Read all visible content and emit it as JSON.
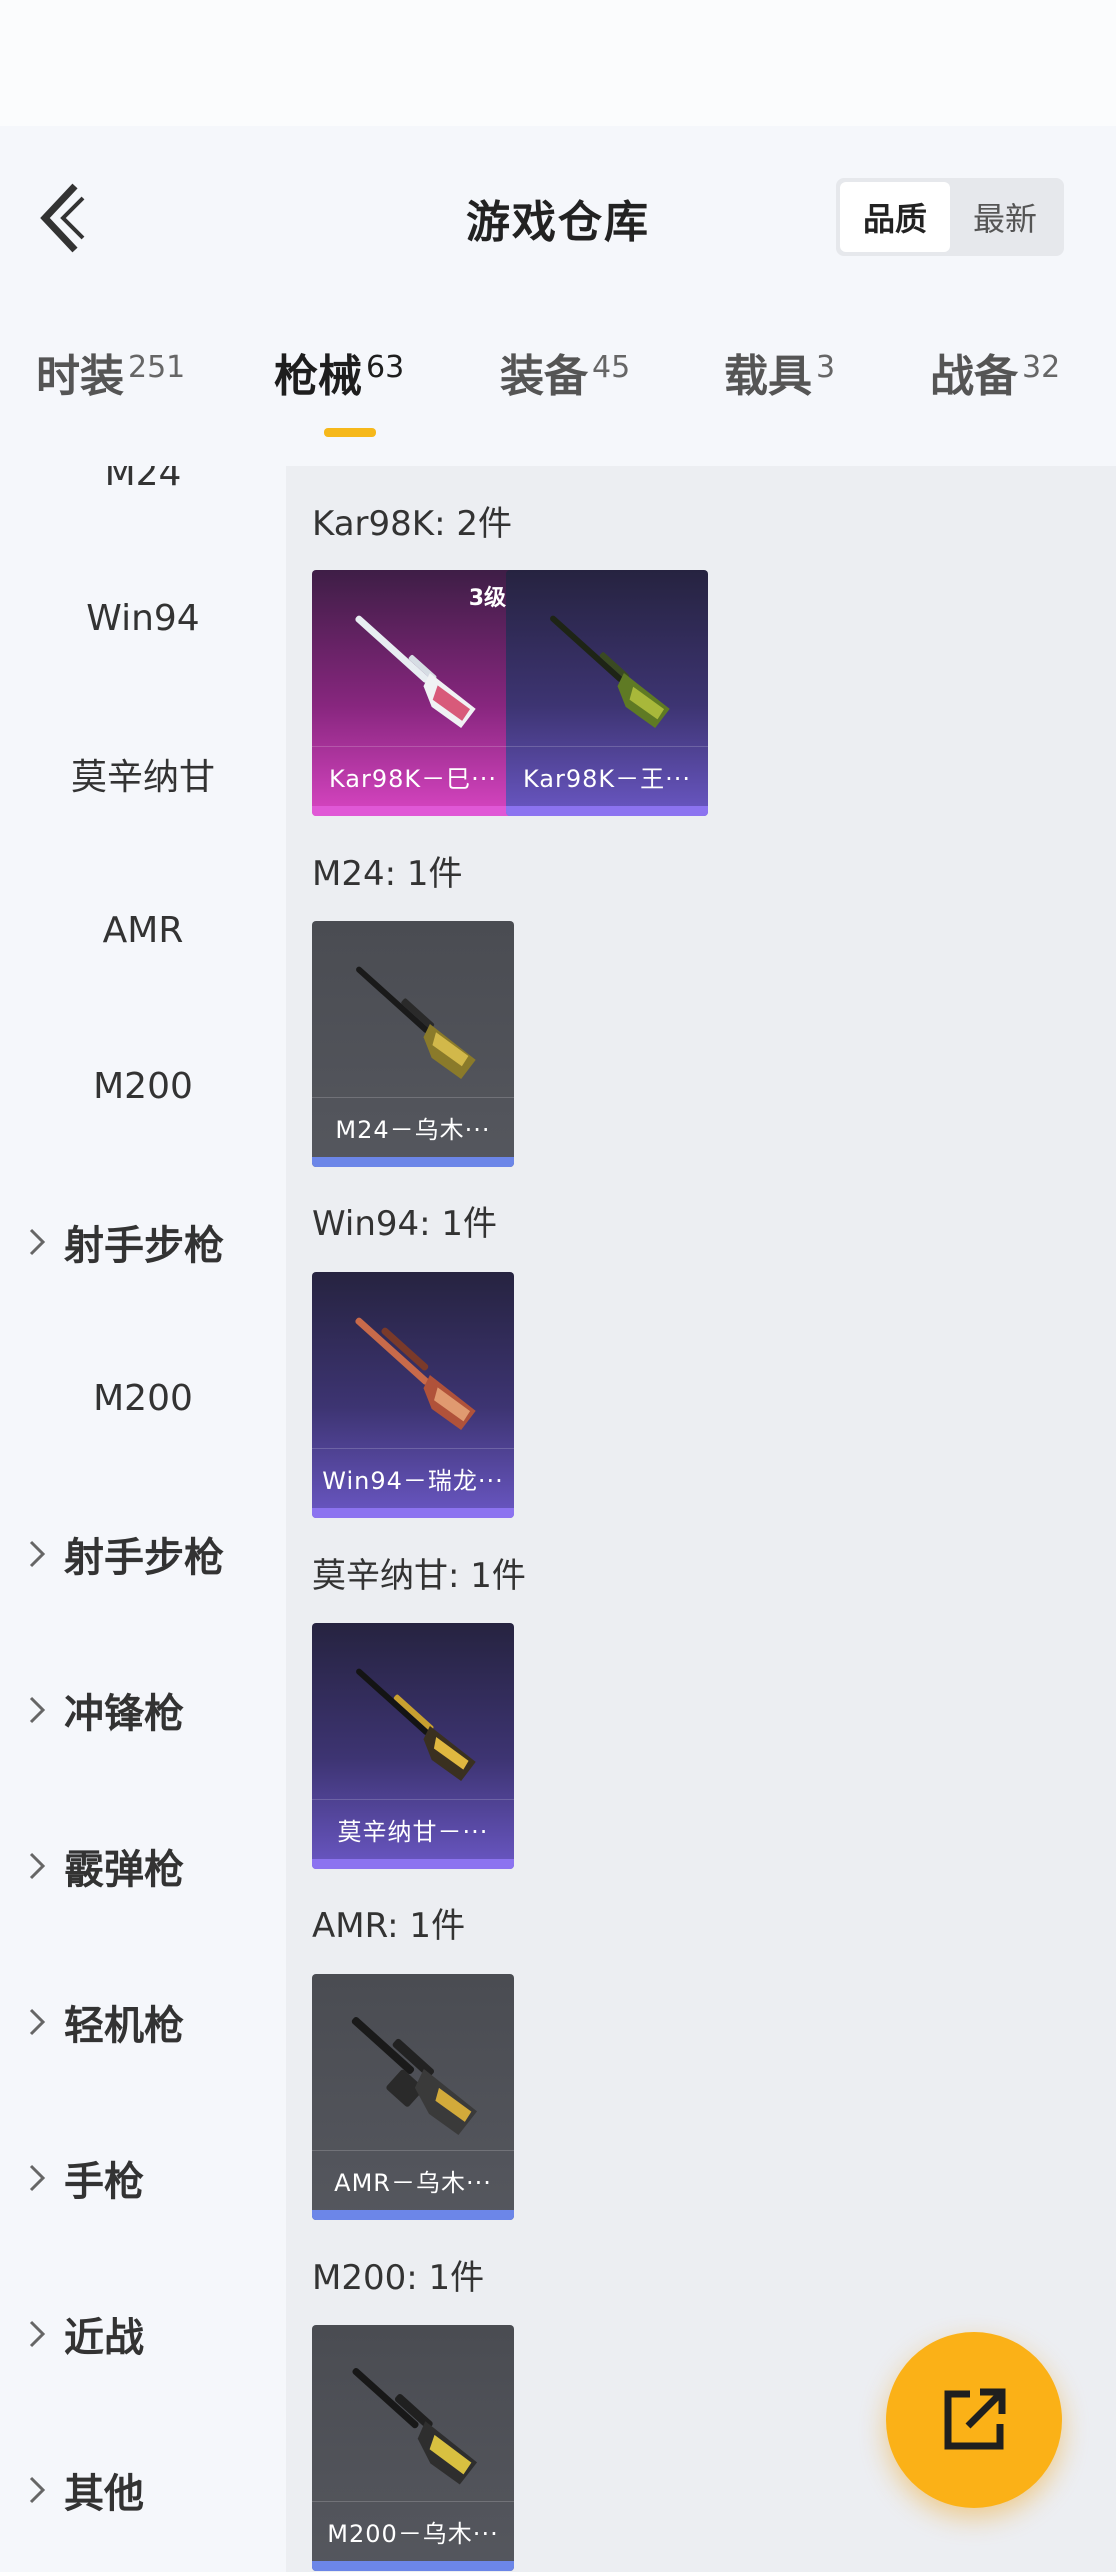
{
  "header": {
    "title": "游戏仓库",
    "sort_options": [
      "品质",
      "最新"
    ],
    "active_sort": "品质"
  },
  "tabs": [
    {
      "name": "时装",
      "count": "251"
    },
    {
      "name": "枪械",
      "count": "63"
    },
    {
      "name": "装备",
      "count": "45"
    },
    {
      "name": "载具",
      "count": "3"
    },
    {
      "name": "战备",
      "count": "32"
    }
  ],
  "active_tab": "枪械",
  "sidebar": {
    "partial_top": "M24",
    "items": [
      {
        "label": "Win94",
        "type": "sub"
      },
      {
        "label": "莫辛纳甘",
        "type": "sub"
      },
      {
        "label": "AMR",
        "type": "sub"
      },
      {
        "label": "M200",
        "type": "sub"
      },
      {
        "label": "射手步枪",
        "type": "category"
      },
      {
        "label": "M200",
        "type": "sub"
      },
      {
        "label": "射手步枪",
        "type": "category"
      },
      {
        "label": "冲锋枪",
        "type": "category"
      },
      {
        "label": "霰弹枪",
        "type": "category"
      },
      {
        "label": "轻机枪",
        "type": "category"
      },
      {
        "label": "手枪",
        "type": "category"
      },
      {
        "label": "近战",
        "type": "category"
      },
      {
        "label": "其他",
        "type": "category"
      }
    ]
  },
  "groups": [
    {
      "title": "Kar98K: 2件",
      "items": [
        {
          "label": "Kar98K－巳···",
          "level": "3级",
          "quality": "pink"
        },
        {
          "label": "Kar98K－王···",
          "quality": "purple"
        }
      ]
    },
    {
      "title": "M24: 1件",
      "items": [
        {
          "label": "M24－乌木···",
          "quality": "grey"
        }
      ]
    },
    {
      "title": "Win94: 1件",
      "items": [
        {
          "label": "Win94－瑞龙···",
          "quality": "purple"
        }
      ]
    },
    {
      "title": "莫辛纳甘: 1件",
      "items": [
        {
          "label": "莫辛纳甘－···",
          "quality": "purple"
        }
      ]
    },
    {
      "title": "AMR: 1件",
      "items": [
        {
          "label": "AMR－乌木···",
          "quality": "grey"
        }
      ]
    },
    {
      "title": "M200: 1件",
      "items": [
        {
          "label": "M200－乌木···",
          "quality": "grey"
        }
      ]
    }
  ],
  "colors": {
    "accent": "#f6b81a",
    "fab": "#fbb117",
    "grey_quality": "#6c86e8",
    "purple_quality": "#8c73f0",
    "pink_quality": "#e058d6"
  },
  "icons": {
    "back": "chevron-left-icon",
    "category_expand": "chevron-right-icon",
    "fab": "share-external-icon"
  }
}
